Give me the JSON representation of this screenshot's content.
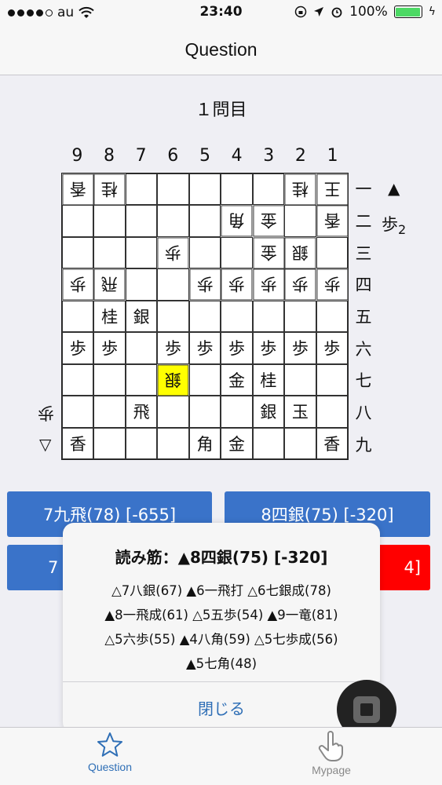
{
  "status_bar": {
    "carrier": "au",
    "time": "23:40",
    "battery": "100%"
  },
  "nav": {
    "title": "Question"
  },
  "question_title": "１問目",
  "board": {
    "columns": [
      "9",
      "8",
      "7",
      "6",
      "5",
      "4",
      "3",
      "2",
      "1"
    ],
    "rows": [
      "一",
      "二",
      "三",
      "四",
      "五",
      "六",
      "七",
      "八",
      "九"
    ],
    "cells": [
      [
        "香g",
        "桂g",
        "",
        "",
        "",
        "",
        "",
        "桂g",
        "王g"
      ],
      [
        "",
        "",
        "",
        "",
        "",
        "角g",
        "金g",
        "",
        "香g"
      ],
      [
        "",
        "",
        "",
        "歩g",
        "",
        "",
        "金g",
        "銀g",
        ""
      ],
      [
        "歩g",
        "飛g",
        "",
        "",
        "歩g",
        "歩g",
        "歩g",
        "歩g",
        "歩g"
      ],
      [
        "",
        "桂",
        "銀",
        "",
        "",
        "",
        "",
        "",
        ""
      ],
      [
        "歩",
        "歩",
        "",
        "歩",
        "歩",
        "歩",
        "歩",
        "歩",
        "歩"
      ],
      [
        "",
        "",
        "",
        "銀gh",
        "",
        "金",
        "桂",
        "",
        ""
      ],
      [
        "",
        "",
        "飛",
        "",
        "",
        "",
        "銀",
        "玉",
        ""
      ],
      [
        "香",
        "",
        "",
        "",
        "角",
        "金",
        "",
        "",
        "香"
      ]
    ],
    "sente_mark": "▲",
    "sente_hand": {
      "piece": "歩",
      "count": "2"
    },
    "gote_mark": "▽",
    "gote_hand": "歩"
  },
  "moves": {
    "m1": "7九飛(78) [-655]",
    "m2": "8四銀(75) [-320]",
    "m3": "7",
    "m4": "4]"
  },
  "popup": {
    "title": "読み筋：▲8四銀(75) [-320]",
    "lines": [
      "△7八銀(67) ▲6一飛打 △6七銀成(78)",
      "▲8一飛成(61) △5五歩(54) ▲9一竜(81)",
      "△5六歩(55) ▲4八角(59) △5七歩成(56)",
      "▲5七角(48)"
    ],
    "close": "閉じる"
  },
  "tabs": {
    "question": "Question",
    "mypage": "Mypage"
  },
  "colors": {
    "accent": "#2f6fb6",
    "button": "#3a73c9",
    "danger": "#ff0000",
    "highlight": "#ffff00"
  }
}
